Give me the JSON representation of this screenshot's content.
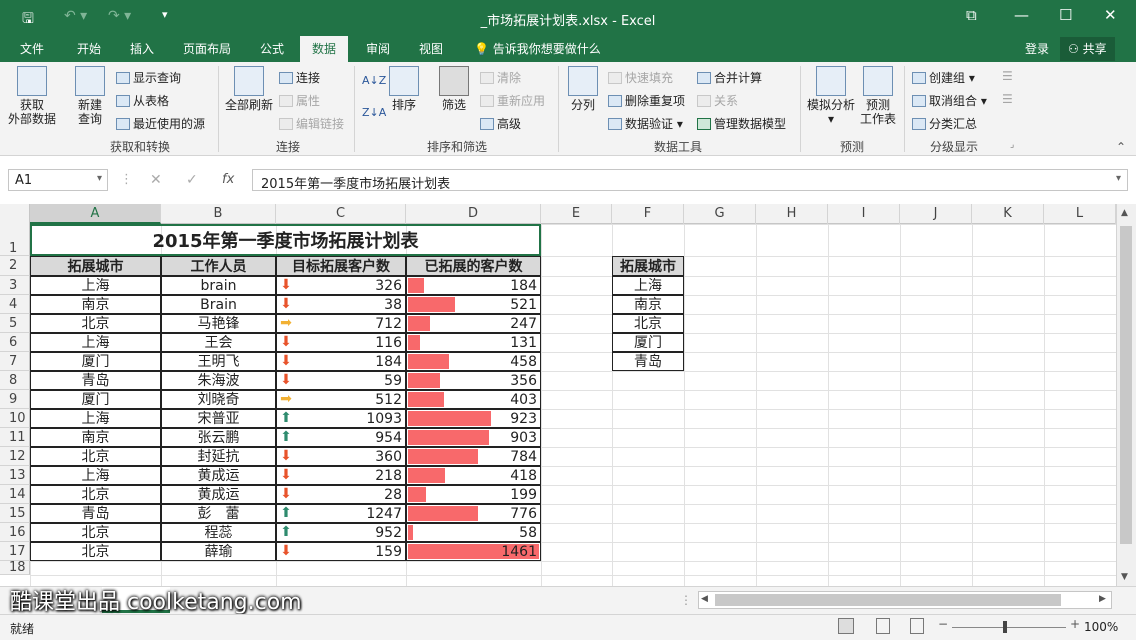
{
  "app": {
    "filename": "_市场拓展计划表.xlsx - Excel"
  },
  "tabs": [
    "文件",
    "开始",
    "插入",
    "页面布局",
    "公式",
    "数据",
    "审阅",
    "视图"
  ],
  "active_tab": "数据",
  "tellme": "告诉我你想要做什么",
  "login": "登录",
  "share": "共享",
  "ribbon": {
    "get_external": "获取\n外部数据",
    "new_query": "新建\n查询",
    "show_query": "显示查询",
    "from_table": "从表格",
    "recent_sources": "最近使用的源",
    "group_get": "获取和转换",
    "refresh_all": "全部刷新",
    "connections": "连接",
    "properties": "属性",
    "edit_links": "编辑链接",
    "group_conn": "连接",
    "sort": "排序",
    "filter": "筛选",
    "clear": "清除",
    "reapply": "重新应用",
    "advanced": "高级",
    "group_sort": "排序和筛选",
    "text_to_col": "分列",
    "flash_fill": "快速填充",
    "remove_dup": "删除重复项",
    "data_validation": "数据验证",
    "consolidate": "合并计算",
    "relationships": "关系",
    "manage_model": "管理数据模型",
    "group_tools": "数据工具",
    "whatif": "模拟分析",
    "forecast_sheet": "预测\n工作表",
    "group_forecast": "预测",
    "group": "创建组",
    "ungroup": "取消组合",
    "subtotal": "分类汇总",
    "group_outline": "分级显示"
  },
  "namebox": "A1",
  "formula": "2015年第一季度市场拓展计划表",
  "columns": [
    "A",
    "B",
    "C",
    "D",
    "E",
    "F",
    "G",
    "H",
    "I",
    "J",
    "K",
    "L"
  ],
  "rows": [
    "1",
    "2",
    "3",
    "4",
    "5",
    "6",
    "7",
    "8",
    "9",
    "10",
    "11",
    "12",
    "13",
    "14",
    "15",
    "16",
    "17",
    "18"
  ],
  "table": {
    "title": "2015年第一季度市场拓展计划表",
    "headers": [
      "拓展城市",
      "工作人员",
      "目标拓展客户数",
      "已拓展的客户数"
    ],
    "data": [
      {
        "city": "上海",
        "person": "brain",
        "target": 326,
        "done": 184,
        "icon": "down"
      },
      {
        "city": "南京",
        "person": "Brain",
        "target": 38,
        "done": 521,
        "icon": "down"
      },
      {
        "city": "北京",
        "person": "马艳锋",
        "target": 712,
        "done": 247,
        "icon": "side"
      },
      {
        "city": "上海",
        "person": "王会",
        "target": 116,
        "done": 131,
        "icon": "down"
      },
      {
        "city": "厦门",
        "person": "王明飞",
        "target": 184,
        "done": 458,
        "icon": "down"
      },
      {
        "city": "青岛",
        "person": "朱海波",
        "target": 59,
        "done": 356,
        "icon": "down"
      },
      {
        "city": "厦门",
        "person": "刘晓奇",
        "target": 512,
        "done": 403,
        "icon": "side"
      },
      {
        "city": "上海",
        "person": "宋普亚",
        "target": 1093,
        "done": 923,
        "icon": "up"
      },
      {
        "city": "南京",
        "person": "张云鹏",
        "target": 954,
        "done": 903,
        "icon": "up"
      },
      {
        "city": "北京",
        "person": "封延抗",
        "target": 360,
        "done": 784,
        "icon": "down"
      },
      {
        "city": "上海",
        "person": "黄成运",
        "target": 218,
        "done": 418,
        "icon": "down"
      },
      {
        "city": "北京",
        "person": "黄成运",
        "target": 28,
        "done": 199,
        "icon": "down"
      },
      {
        "city": "青岛",
        "person": "彭　蕾",
        "target": 1247,
        "done": 776,
        "icon": "up"
      },
      {
        "city": "北京",
        "person": "程蕊",
        "target": 952,
        "done": 58,
        "icon": "up"
      },
      {
        "city": "北京",
        "person": "薛瑜",
        "target": 159,
        "done": 1461,
        "icon": "down"
      }
    ]
  },
  "city_list": {
    "header": "拓展城市",
    "items": [
      "上海",
      "南京",
      "北京",
      "厦门",
      "青岛"
    ]
  },
  "status": {
    "ready": "就绪",
    "zoom": "100%"
  },
  "watermark": "酷课堂出品 coolketang.com",
  "colors": {
    "accent": "#217346",
    "bar": "#f8696b",
    "up": "#2e8b6e",
    "down": "#e8532b",
    "side": "#f2b134"
  }
}
